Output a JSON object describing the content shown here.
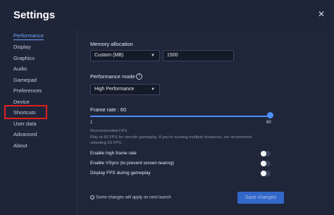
{
  "window": {
    "title": "Settings",
    "close_symbol": "✕"
  },
  "sidebar": {
    "items": [
      {
        "label": "Performance"
      },
      {
        "label": "Display"
      },
      {
        "label": "Graphics"
      },
      {
        "label": "Audio"
      },
      {
        "label": "Gamepad"
      },
      {
        "label": "Preferences"
      },
      {
        "label": "Device"
      },
      {
        "label": "Shortcuts"
      },
      {
        "label": "User data"
      },
      {
        "label": "Advanced"
      },
      {
        "label": "About"
      }
    ],
    "active": "Performance",
    "highlighted": "Shortcuts"
  },
  "memory": {
    "label": "Memory allocation",
    "select_value": "Custom (MB)",
    "input_value": "1500"
  },
  "performance_mode": {
    "label": "Performance mode",
    "help_symbol": "?",
    "select_value": "High Performance"
  },
  "frame_rate": {
    "label": "Frame rate : 60",
    "min_label": "1",
    "max_label": "60",
    "value": 60,
    "min": 1,
    "max": 60
  },
  "recommended": {
    "title": "Recommended FPS",
    "line1": "Play at 60 FPS for smooth gameplay. If you're running multiple instances, we recommend",
    "line2": "selecting 20 FPS."
  },
  "toggles": [
    {
      "label": "Enable high frame rate",
      "on": false
    },
    {
      "label": "Enable VSync (to prevent screen tearing)",
      "on": false
    },
    {
      "label": "Display FPS during gameplay",
      "on": false
    }
  ],
  "footer": {
    "note": "Some changes will apply on next launch",
    "info_symbol": "i",
    "save_label": "Save changes"
  },
  "colors": {
    "accent": "#4e90ff",
    "highlight_box": "#e02020",
    "background": "#20263a"
  }
}
